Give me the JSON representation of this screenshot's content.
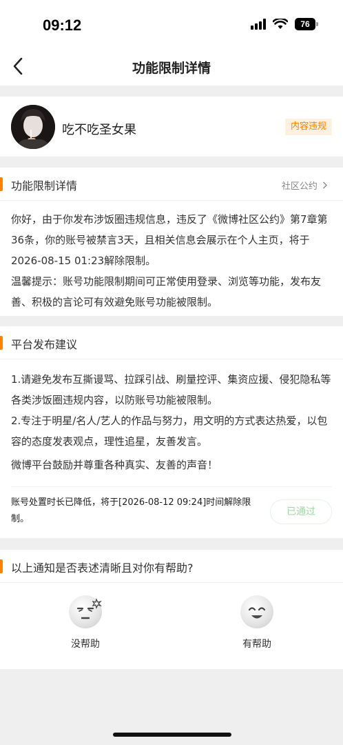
{
  "status_bar": {
    "time": "09:12",
    "battery": "76"
  },
  "nav": {
    "title": "功能限制详情"
  },
  "user": {
    "name": "吃不吃圣女果",
    "tag": "内容违规"
  },
  "detail_section": {
    "title": "功能限制详情",
    "link_label": "社区公约",
    "paragraph1": "你好，由于你发布涉饭圈违规信息，违反了《微博社区公约》第7章第36条，你的账号被禁言3天，且相关信息会展示在个人主页，将于2026-08-15 01:23解除限制。",
    "paragraph2": "温馨提示：账号功能限制期间可正常使用登录、浏览等功能，发布友善、积极的言论可有效避免账号功能被限制。"
  },
  "advice_section": {
    "title": "平台发布建议",
    "item1": "1.请避免发布互撕谩骂、拉踩引战、刷量控评、集资应援、侵犯隐私等各类涉饭圈违规内容，以防账号功能被限制。",
    "item2": "2.专注于明星/名人/艺人的作品与努力，用文明的方式表达热爱，以包容的态度发表观点，理性追星，友善发言。",
    "encourage": "微博平台鼓励并尊重各种真实、友善的声音！",
    "reduce_notice": "账号处置时长已降低，将于[2026-08-12 09:24]时间解除限制。",
    "passed_label": "已通过"
  },
  "feedback_section": {
    "title": "以上通知是否表述清晰且对你有帮助?",
    "options": [
      {
        "label": "没帮助",
        "icon": "unhappy-face-icon"
      },
      {
        "label": "有帮助",
        "icon": "smile-face-icon"
      }
    ]
  },
  "colors": {
    "accent": "#ff8200",
    "tag_bg": "#fff1e0",
    "passed_text": "#9fd79f",
    "page_bg": "#efefef"
  }
}
